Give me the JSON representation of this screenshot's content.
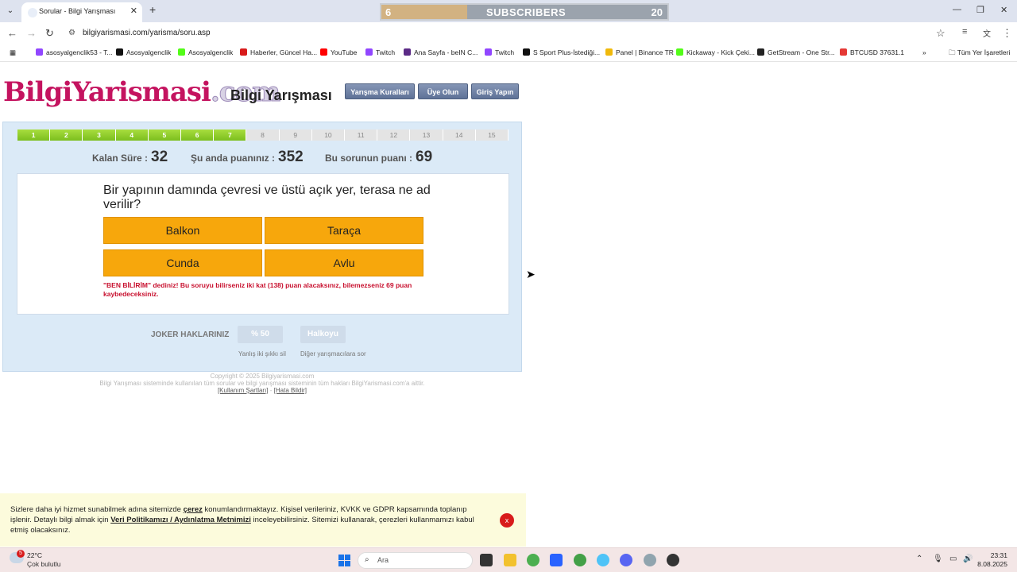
{
  "browser": {
    "tab_title": "Sorular - Bilgi Yarışması",
    "url": "bilgiyarismasi.com/yarisma/soru.asp",
    "subscribers": {
      "left": "6",
      "label": "SUBSCRIBERS",
      "right": "20",
      "progress_fraction": 0.3
    },
    "bookmarks": [
      {
        "label": "asosyalgenclik53 - T...",
        "color": "#9146ff"
      },
      {
        "label": "Asosyalgenclik",
        "color": "#111111"
      },
      {
        "label": "Asosyalgenclik",
        "color": "#53fc18"
      },
      {
        "label": "Haberler, Güncel Ha...",
        "color": "#d81b1b"
      },
      {
        "label": "YouTube",
        "color": "#ff0000"
      },
      {
        "label": "Twitch",
        "color": "#9146ff"
      },
      {
        "label": "Ana Sayfa - beIN C...",
        "color": "#5b2a86"
      },
      {
        "label": "Twitch",
        "color": "#9146ff"
      },
      {
        "label": "S Sport Plus-İstediği...",
        "color": "#111111"
      },
      {
        "label": "Panel | Binance TR",
        "color": "#f0b90b"
      },
      {
        "label": "Kickaway - Kick Çeki...",
        "color": "#53fc18"
      },
      {
        "label": "GetStream - One Str...",
        "color": "#222222"
      },
      {
        "label": "BTCUSD 37631.1",
        "color": "#e53935"
      }
    ],
    "all_bookmarks": "Tüm Yer İşaretleri"
  },
  "site": {
    "logo": {
      "part1": "Bilgi",
      "part2": "Yarismasi",
      "part3": ".com"
    },
    "heading": "Bilgi Yarışması",
    "nav": [
      "Yarışma Kuralları",
      "Üye Olun",
      "Giriş Yapın"
    ]
  },
  "quiz": {
    "steps": [
      "1",
      "2",
      "3",
      "4",
      "5",
      "6",
      "7",
      "8",
      "9",
      "10",
      "11",
      "12",
      "13",
      "14",
      "15"
    ],
    "completed_steps": 7,
    "time_label": "Kalan Süre :",
    "time_value": "32",
    "score_label": "Şu anda puanınız :",
    "score_value": "352",
    "question_points_label": "Bu sorunun puanı :",
    "question_points_value": "69",
    "question": "Bir yapının damında çevresi ve üstü açık yer, terasa ne ad verilir?",
    "answers": [
      "Balkon",
      "Taraça",
      "Cunda",
      "Avlu"
    ],
    "warning": "\"BEN BİLİRİM\" dediniz! Bu soruyu bilirseniz iki kat (138) puan alacaksınız, bilemezseniz 69 puan kaybedeceksiniz.",
    "joker_label": "JOKER HAKLARINIZ",
    "joker_fifty": "% 50",
    "joker_fifty_caption": "Yanlış iki şıkkı sil",
    "joker_audience": "Halkoyu",
    "joker_audience_caption": "Diğer yarışmacılara sor"
  },
  "footer": {
    "copyright": "Copyright © 2025 Bilgiyarismasi.com",
    "rights": "Bilgi Yarışması sisteminde kullanılan tüm sorular ve bilgi yarışması sisteminin tüm hakları BilgiYarismasi.com'a aittir.",
    "terms": "[Kullanım Şartları]",
    "sep": "-",
    "report": "[Hata Bildir]"
  },
  "cookie": {
    "text1": "Sizlere daha iyi hizmet sunabilmek adına sitemizde",
    "link1": "çerez",
    "text2": "konumlandırmaktayız. Kişisel verileriniz, KVKK ve GDPR kapsamında toplanıp işlenir. Detaylı bilgi almak için",
    "link2": "Veri Politikamızı / Aydınlatma Metnimizi",
    "text3": "inceleyebilirsiniz. Sitemizi kullanarak, çerezleri kullanmamızı kabul etmiş olacaksınız.",
    "close": "x"
  },
  "taskbar": {
    "weather_temp": "22°C",
    "weather_desc": "Çok bulutlu",
    "weather_badge": "5",
    "search": "Ara",
    "time": "23:31",
    "date": "8.08.2025"
  }
}
